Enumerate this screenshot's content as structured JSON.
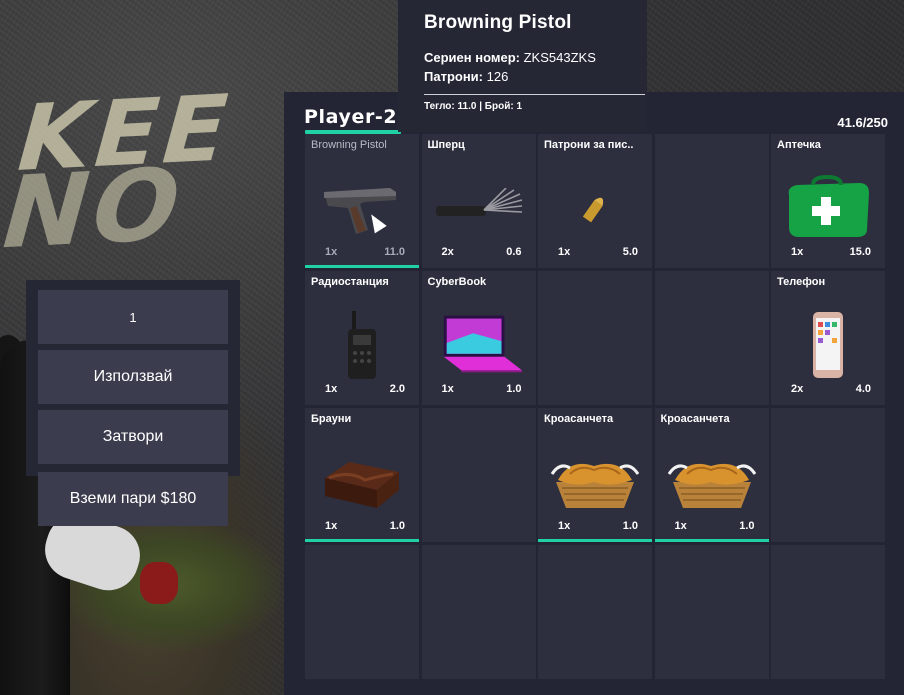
{
  "tooltip": {
    "title": "Browning Pistol",
    "serial_label": "Сериен номер:",
    "serial_value": "ZKS543ZKS",
    "ammo_label": "Патрони:",
    "ammo_value": "126",
    "footer": "Тегло: 11.0 | Брой: 1"
  },
  "inventory": {
    "player_name": "Player-23",
    "weight": "41.6/250",
    "accent_color": "#1fd1a5",
    "slots": [
      {
        "name": "Browning Pistol",
        "count": "1x",
        "weight": "11.0",
        "icon": "pistol-icon",
        "bar": true,
        "muted": true
      },
      {
        "name": "Шперц",
        "count": "2x",
        "weight": "0.6",
        "icon": "lockpick-icon",
        "bar": false
      },
      {
        "name": "Патрони за пис..",
        "count": "1x",
        "weight": "5.0",
        "icon": "bullet-icon",
        "bar": false
      },
      {
        "name": "",
        "count": "",
        "weight": "",
        "icon": "",
        "bar": false
      },
      {
        "name": "Аптечка",
        "count": "1x",
        "weight": "15.0",
        "icon": "medkit-icon",
        "bar": false
      },
      {
        "name": "Радиостанция",
        "count": "1x",
        "weight": "2.0",
        "icon": "radio-icon",
        "bar": false
      },
      {
        "name": "CyberBook",
        "count": "1x",
        "weight": "1.0",
        "icon": "laptop-icon",
        "bar": false
      },
      {
        "name": "",
        "count": "",
        "weight": "",
        "icon": "",
        "bar": false
      },
      {
        "name": "",
        "count": "",
        "weight": "",
        "icon": "",
        "bar": false
      },
      {
        "name": "Телефон",
        "count": "2x",
        "weight": "4.0",
        "icon": "phone-icon",
        "bar": false
      },
      {
        "name": "Брауни",
        "count": "1x",
        "weight": "1.0",
        "icon": "brownie-icon",
        "bar": true
      },
      {
        "name": "",
        "count": "",
        "weight": "",
        "icon": "",
        "bar": false
      },
      {
        "name": "Кроасанчета",
        "count": "1x",
        "weight": "1.0",
        "icon": "croissant-icon",
        "bar": true
      },
      {
        "name": "Кроасанчета",
        "count": "1x",
        "weight": "1.0",
        "icon": "croissant-icon",
        "bar": true
      },
      {
        "name": "",
        "count": "",
        "weight": "",
        "icon": "",
        "bar": false
      },
      {
        "name": "",
        "count": "",
        "weight": "",
        "icon": "",
        "bar": false
      },
      {
        "name": "",
        "count": "",
        "weight": "",
        "icon": "",
        "bar": false
      },
      {
        "name": "",
        "count": "",
        "weight": "",
        "icon": "",
        "bar": false
      },
      {
        "name": "",
        "count": "",
        "weight": "",
        "icon": "",
        "bar": false
      },
      {
        "name": "",
        "count": "",
        "weight": "",
        "icon": "",
        "bar": false
      }
    ]
  },
  "menu": {
    "quantity": "1",
    "use": "Използвай",
    "close": "Затвори",
    "take_money": "Вземи пари $180"
  },
  "background": {
    "road_text_1": "KEE",
    "road_text_2": "NO"
  }
}
